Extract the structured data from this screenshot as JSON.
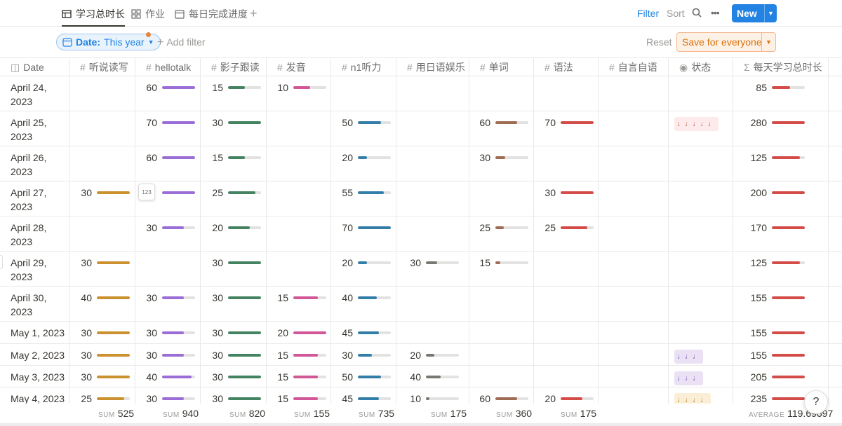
{
  "views": {
    "tabs": [
      {
        "label": "学习总时长",
        "icon": "table-icon",
        "active": true
      },
      {
        "label": "作业",
        "icon": "gallery-icon",
        "active": false
      },
      {
        "label": "每日完成进度",
        "icon": "calendar-icon",
        "active": false
      }
    ],
    "add_view": "+"
  },
  "toolbar": {
    "filter": "Filter",
    "sort": "Sort",
    "more": "•••",
    "new": "New"
  },
  "filters": {
    "date_label": "Date:",
    "date_value": "This year",
    "add_filter": "Add filter",
    "reset": "Reset",
    "save": "Save for everyone"
  },
  "columns": [
    {
      "key": "date",
      "label": "Date",
      "icon": "◫"
    },
    {
      "key": "c1",
      "label": "听说读写",
      "icon": "#"
    },
    {
      "key": "c2",
      "label": "hellotalk",
      "icon": "#"
    },
    {
      "key": "c3",
      "label": "影子跟读",
      "icon": "#"
    },
    {
      "key": "c4",
      "label": "发音",
      "icon": "#"
    },
    {
      "key": "c5",
      "label": "n1听力",
      "icon": "#"
    },
    {
      "key": "c6",
      "label": "用日语娱乐",
      "icon": "#"
    },
    {
      "key": "c7",
      "label": "单词",
      "icon": "#"
    },
    {
      "key": "c8",
      "label": "语法",
      "icon": "#"
    },
    {
      "key": "c9",
      "label": "自言自语",
      "icon": "#"
    },
    {
      "key": "status",
      "label": "状态",
      "icon": "◉"
    },
    {
      "key": "total",
      "label": "每天学习总时长",
      "icon": "Σ"
    }
  ],
  "bar_colors": {
    "c1": "#cb912f",
    "c2": "#9a6dd7",
    "c3": "#448361",
    "c4": "#d15796",
    "c5": "#337ea9",
    "c6": "#787774",
    "c7": "#9f6b53",
    "c8": "#d44c47",
    "total": "#d44c47"
  },
  "bar_fraction": {
    "c1": [
      null,
      null,
      null,
      1.0,
      null,
      1.0,
      1.0,
      1.0,
      1.0,
      1.0,
      0.83
    ],
    "c2": [
      1.0,
      1.0,
      1.0,
      1.0,
      0.65,
      null,
      0.65,
      0.65,
      0.65,
      0.9,
      0.65
    ],
    "c3": [
      0.5,
      1.0,
      0.5,
      0.83,
      0.66,
      1.0,
      1.0,
      1.0,
      1.0,
      1.0,
      1.0
    ],
    "c4": [
      0.5,
      null,
      null,
      null,
      null,
      null,
      0.75,
      1.0,
      0.75,
      0.75,
      0.75
    ],
    "c5": [
      null,
      0.71,
      0.28,
      0.78,
      1.0,
      0.28,
      0.57,
      0.64,
      0.43,
      0.71,
      0.64
    ],
    "c6": [
      null,
      null,
      null,
      null,
      null,
      0.35,
      null,
      null,
      0.25,
      0.45,
      0.1
    ],
    "c7": [
      null,
      0.65,
      0.3,
      null,
      0.25,
      0.15,
      null,
      null,
      null,
      null,
      0.65
    ],
    "c8": [
      null,
      1.0,
      null,
      1.0,
      0.8,
      null,
      null,
      null,
      null,
      null,
      0.65
    ],
    "total": [
      0.55,
      1.0,
      0.85,
      1.0,
      1.0,
      0.85,
      1.0,
      1.0,
      1.0,
      1.0,
      1.0
    ]
  },
  "rows": [
    {
      "date": "April 24, 2023",
      "c1": null,
      "c2": "60",
      "c3": "15",
      "c4": "10",
      "c5": null,
      "c6": null,
      "c7": null,
      "c8": null,
      "status": null,
      "total": "85"
    },
    {
      "date": "April 25, 2023",
      "c1": null,
      "c2": "70",
      "c3": "30",
      "c4": null,
      "c5": "50",
      "c6": null,
      "c7": "60",
      "c8": "70",
      "status": "♩♩♩♩♩",
      "status_color": "red",
      "total": "280"
    },
    {
      "date": "April 26, 2023",
      "c1": null,
      "c2": "60",
      "c3": "15",
      "c4": null,
      "c5": "20",
      "c6": null,
      "c7": "30",
      "c8": null,
      "status": null,
      "total": "125"
    },
    {
      "date": "April 27, 2023",
      "c1": "30",
      "c2": "",
      "c3": "25",
      "c4": null,
      "c5": "55",
      "c6": null,
      "c7": null,
      "c8": "30",
      "status": null,
      "total": "200"
    },
    {
      "date": "April 28, 2023",
      "c1": null,
      "c2": "30",
      "c3": "20",
      "c4": null,
      "c5": "70",
      "c6": null,
      "c7": "25",
      "c8": "25",
      "status": null,
      "total": "170"
    },
    {
      "date": "April 29, 2023",
      "c1": "30",
      "c2": null,
      "c3": "30",
      "c4": null,
      "c5": "20",
      "c6": "30",
      "c7": "15",
      "c8": null,
      "status": null,
      "total": "125"
    },
    {
      "date": "April 30, 2023",
      "c1": "40",
      "c2": "30",
      "c3": "30",
      "c4": "15",
      "c5": "40",
      "c6": null,
      "c7": null,
      "c8": null,
      "status": null,
      "total": "155"
    },
    {
      "date": "May 1, 2023",
      "c1": "30",
      "c2": "30",
      "c3": "30",
      "c4": "20",
      "c5": "45",
      "c6": null,
      "c7": null,
      "c8": null,
      "status": null,
      "total": "155"
    },
    {
      "date": "May 2, 2023",
      "c1": "30",
      "c2": "30",
      "c3": "30",
      "c4": "15",
      "c5": "30",
      "c6": "20",
      "c7": null,
      "c8": null,
      "status": "♩♩♩",
      "status_color": "purple",
      "total": "155"
    },
    {
      "date": "May 3, 2023",
      "c1": "30",
      "c2": "40",
      "c3": "30",
      "c4": "15",
      "c5": "50",
      "c6": "40",
      "c7": null,
      "c8": null,
      "status": "♩♩♩",
      "status_color": "purple",
      "total": "205"
    },
    {
      "date": "May 4, 2023",
      "c1": "25",
      "c2": "30",
      "c3": "30",
      "c4": "15",
      "c5": "45",
      "c6": "10",
      "c7": "60",
      "c8": "20",
      "status": "♩♩♩♩",
      "status_color": "yellow",
      "total": "235"
    }
  ],
  "tooltip_chip": "123",
  "footer": {
    "c1": {
      "label": "SUM",
      "value": "525"
    },
    "c2": {
      "label": "SUM",
      "value": "940"
    },
    "c3": {
      "label": "SUM",
      "value": "820"
    },
    "c4": {
      "label": "SUM",
      "value": "155"
    },
    "c5": {
      "label": "SUM",
      "value": "735"
    },
    "c6": {
      "label": "SUM",
      "value": "175"
    },
    "c7": {
      "label": "SUM",
      "value": "360"
    },
    "c8": {
      "label": "SUM",
      "value": "175"
    },
    "total": {
      "label": "AVERAGE",
      "value": "119.69697"
    }
  },
  "help": "?"
}
